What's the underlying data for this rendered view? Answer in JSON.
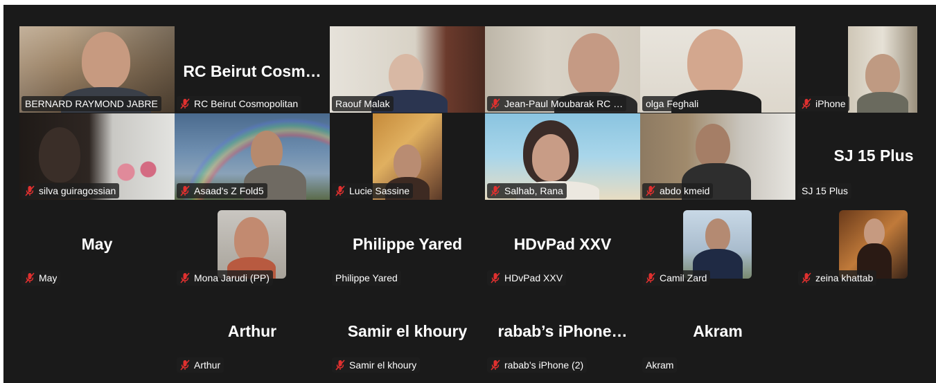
{
  "colors": {
    "background": "#1a1a1a",
    "active_speaker": "#27d07a",
    "muted_icon": "#e0302f"
  },
  "tiles": [
    {
      "name": "BERNARD RAYMOND  JABRE",
      "muted": false,
      "kind": "video"
    },
    {
      "name": "RC Beirut Cosmopolitan",
      "big": "RC Beirut Cosm…",
      "muted": true,
      "kind": "name"
    },
    {
      "name": "Raouf Malak",
      "muted": false,
      "kind": "video"
    },
    {
      "name": "Jean-Paul Moubarak RC …",
      "muted": true,
      "kind": "video"
    },
    {
      "name": "olga Feghali",
      "muted": false,
      "kind": "video",
      "active": true
    },
    {
      "name": "iPhone",
      "muted": true,
      "kind": "video"
    },
    {
      "name": "silva guiragossian",
      "muted": true,
      "kind": "video"
    },
    {
      "name": "Asaad's Z Fold5",
      "muted": true,
      "kind": "video"
    },
    {
      "name": "Lucie Sassine",
      "muted": true,
      "kind": "video"
    },
    {
      "name": "Salhab, Rana",
      "muted": true,
      "kind": "video"
    },
    {
      "name": "abdo kmeid",
      "muted": true,
      "kind": "video"
    },
    {
      "name": "SJ 15 Plus",
      "big": "SJ 15 Plus",
      "muted": false,
      "kind": "name"
    },
    {
      "name": "May",
      "big": "May",
      "muted": true,
      "kind": "name"
    },
    {
      "name": "Mona Jarudi (PP)",
      "muted": true,
      "kind": "avatar"
    },
    {
      "name": "Philippe Yared",
      "big": "Philippe Yared",
      "muted": false,
      "kind": "name"
    },
    {
      "name": "HDvPad XXV",
      "big": "HDvPad XXV",
      "muted": true,
      "kind": "name"
    },
    {
      "name": "Camil Zard",
      "muted": true,
      "kind": "avatar"
    },
    {
      "name": "zeina khattab",
      "muted": true,
      "kind": "avatar"
    },
    {
      "name": "Arthur",
      "big": "Arthur",
      "muted": true,
      "kind": "name"
    },
    {
      "name": "Samir el khoury",
      "big": "Samir el khoury",
      "muted": true,
      "kind": "name"
    },
    {
      "name": "rabab’s iPhone (2)",
      "big": "rabab’s  iPhone…",
      "muted": true,
      "kind": "name"
    },
    {
      "name": "Akram",
      "big": "Akram",
      "muted": false,
      "kind": "name"
    }
  ]
}
